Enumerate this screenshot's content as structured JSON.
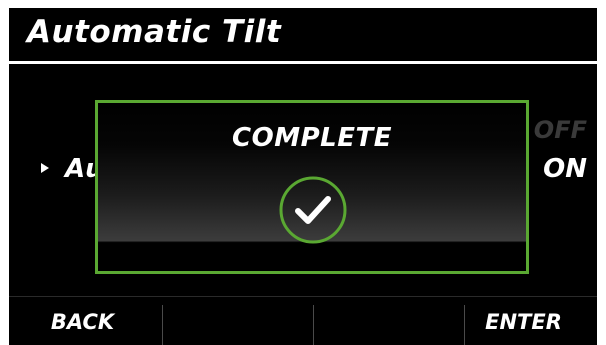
{
  "header": {
    "title": "Automatic Tilt"
  },
  "setting": {
    "label": "Au",
    "options": [
      {
        "label": "OFF",
        "selected": false
      },
      {
        "label": "ON",
        "selected": true
      }
    ]
  },
  "dialog": {
    "title": "COMPLETE",
    "icon": "checkmark-icon",
    "border_color": "#5aa832"
  },
  "footer": {
    "left_key": "BACK",
    "center_left_key": "",
    "center_right_key": "",
    "right_key": "ENTER"
  }
}
